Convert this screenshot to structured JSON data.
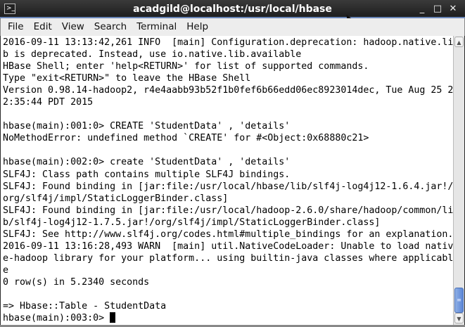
{
  "window": {
    "title": "acadgild@localhost:/usr/local/hbase",
    "controls": {
      "minimize": "_",
      "maximize": "□",
      "close": "✕"
    }
  },
  "menu": [
    "File",
    "Edit",
    "View",
    "Search",
    "Terminal",
    "Help"
  ],
  "terminal": {
    "lines": [
      "2016-09-11 13:13:42,261 INFO  [main] Configuration.deprecation: hadoop.native.li",
      "b is deprecated. Instead, use io.native.lib.available",
      "HBase Shell; enter 'help<RETURN>' for list of supported commands.",
      "Type \"exit<RETURN>\" to leave the HBase Shell",
      "Version 0.98.14-hadoop2, r4e4aabb93b52f1b0fef6b66edd06ec8923014dec, Tue Aug 25 2",
      "2:35:44 PDT 2015",
      "",
      "hbase(main):001:0> CREATE 'StudentData' , 'details'",
      "NoMethodError: undefined method `CREATE' for #<Object:0x68880c21>",
      "",
      "hbase(main):002:0> create 'StudentData' , 'details'",
      "SLF4J: Class path contains multiple SLF4J bindings.",
      "SLF4J: Found binding in [jar:file:/usr/local/hbase/lib/slf4j-log4j12-1.6.4.jar!/",
      "org/slf4j/impl/StaticLoggerBinder.class]",
      "SLF4J: Found binding in [jar:file:/usr/local/hadoop-2.6.0/share/hadoop/common/li",
      "b/slf4j-log4j12-1.7.5.jar!/org/slf4j/impl/StaticLoggerBinder.class]",
      "SLF4J: See http://www.slf4j.org/codes.html#multiple_bindings for an explanation.",
      "2016-09-11 13:16:28,493 WARN  [main] util.NativeCodeLoader: Unable to load nativ",
      "e-hadoop library for your platform... using builtin-java classes where applicabl",
      "e",
      "0 row(s) in 5.2340 seconds",
      "",
      "=> Hbase::Table - StudentData"
    ],
    "prompt": "hbase(main):003:0> "
  }
}
